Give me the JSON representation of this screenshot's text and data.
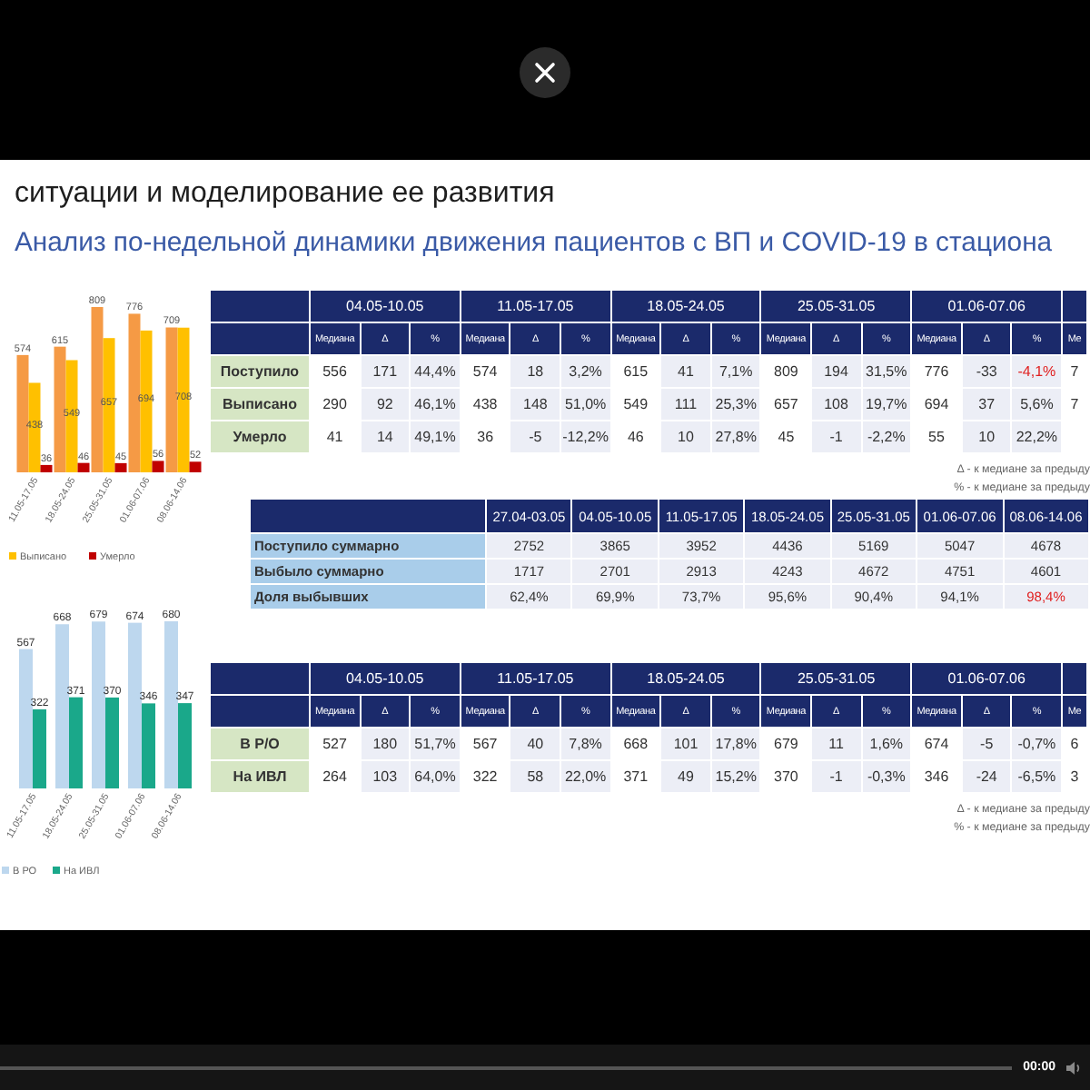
{
  "player": {
    "time": "00:00",
    "progress": {
      "level": 0
    }
  },
  "slide": {
    "heading": "ситуации и моделирование ее развития",
    "subtitle": "Анализ по-недельной динамики движения пациентов с ВП и COVID-19 в стациона",
    "admissions_chart": {
      "chart_data": {
        "type": "bar",
        "categories": [
          "11.05-17.05",
          "18.05-24.05",
          "25.05-31.05",
          "01.06-07.06",
          "08.06-14.06"
        ],
        "data_labels": true,
        "legend": true,
        "series": [
          {
            "color": "#f59a45",
            "values": [
              574,
              615,
              809,
              776,
              709
            ]
          },
          {
            "name": "Выписано",
            "color": "#ffc000",
            "values": [
              438,
              549,
              657,
              694,
              708
            ]
          },
          {
            "name": "Умерло",
            "color": "#c00000",
            "values": [
              36,
              46,
              45,
              56,
              52
            ]
          }
        ]
      }
    },
    "admissions_table": {
      "groups": [
        "04.05-10.05",
        "11.05-17.05",
        "18.05-24.05",
        "25.05-31.05",
        "01.06-07.06"
      ],
      "subheaders": [
        "Медиана",
        "Δ",
        "%",
        "Медиана",
        "Δ",
        "%",
        "Медиана",
        "Δ",
        "%",
        "Медиана",
        "Δ",
        "%",
        "Медиана",
        "Δ",
        "%",
        "Ме"
      ],
      "rows": [
        {
          "label": "Поступило",
          "cells": [
            {
              "text": "556",
              "alert": false
            },
            {
              "text": "171",
              "alert": false
            },
            {
              "text": "44,4%",
              "alert": false
            },
            {
              "text": "574",
              "alert": false
            },
            {
              "text": "18",
              "alert": false
            },
            {
              "text": "3,2%",
              "alert": false
            },
            {
              "text": "615",
              "alert": false
            },
            {
              "text": "41",
              "alert": false
            },
            {
              "text": "7,1%",
              "alert": false
            },
            {
              "text": "809",
              "alert": false
            },
            {
              "text": "194",
              "alert": false
            },
            {
              "text": "31,5%",
              "alert": false
            },
            {
              "text": "776",
              "alert": false
            },
            {
              "text": "-33",
              "alert": false
            },
            {
              "text": "-4,1%",
              "alert": true
            },
            {
              "text": "7",
              "alert": false
            }
          ]
        },
        {
          "label": "Выписано",
          "cells": [
            {
              "text": "290",
              "alert": false
            },
            {
              "text": "92",
              "alert": false
            },
            {
              "text": "46,1%",
              "alert": false
            },
            {
              "text": "438",
              "alert": false
            },
            {
              "text": "148",
              "alert": false
            },
            {
              "text": "51,0%",
              "alert": false
            },
            {
              "text": "549",
              "alert": false
            },
            {
              "text": "111",
              "alert": false
            },
            {
              "text": "25,3%",
              "alert": false
            },
            {
              "text": "657",
              "alert": false
            },
            {
              "text": "108",
              "alert": false
            },
            {
              "text": "19,7%",
              "alert": false
            },
            {
              "text": "694",
              "alert": false
            },
            {
              "text": "37",
              "alert": false
            },
            {
              "text": "5,6%",
              "alert": false
            },
            {
              "text": "7",
              "alert": false
            }
          ]
        },
        {
          "label": "Умерло",
          "cells": [
            {
              "text": "41",
              "alert": false
            },
            {
              "text": "14",
              "alert": false
            },
            {
              "text": "49,1%",
              "alert": false
            },
            {
              "text": "36",
              "alert": false
            },
            {
              "text": "-5",
              "alert": false
            },
            {
              "text": "-12,2%",
              "alert": false
            },
            {
              "text": "46",
              "alert": false
            },
            {
              "text": "10",
              "alert": false
            },
            {
              "text": "27,8%",
              "alert": false
            },
            {
              "text": "45",
              "alert": false
            },
            {
              "text": "-1",
              "alert": false
            },
            {
              "text": "-2,2%",
              "alert": false
            },
            {
              "text": "55",
              "alert": false
            },
            {
              "text": "10",
              "alert": false
            },
            {
              "text": "22,2%",
              "alert": false
            }
          ]
        }
      ],
      "notes": [
        "Δ - к медиане за предыду",
        "% - к медиане за предыду"
      ]
    },
    "cumulative_table": {
      "columns": [
        "27.04-03.05",
        "04.05-10.05",
        "11.05-17.05",
        "18.05-24.05",
        "25.05-31.05",
        "01.06-07.06",
        "08.06-14.06"
      ],
      "rows": [
        {
          "label": "Поступило суммарно",
          "cells": [
            {
              "text": "2752",
              "alert": false
            },
            {
              "text": "3865",
              "alert": false
            },
            {
              "text": "3952",
              "alert": false
            },
            {
              "text": "4436",
              "alert": false
            },
            {
              "text": "5169",
              "alert": false
            },
            {
              "text": "5047",
              "alert": false
            },
            {
              "text": "4678",
              "alert": false
            }
          ]
        },
        {
          "label": "Выбыло суммарно",
          "cells": [
            {
              "text": "1717",
              "alert": false
            },
            {
              "text": "2701",
              "alert": false
            },
            {
              "text": "2913",
              "alert": false
            },
            {
              "text": "4243",
              "alert": false
            },
            {
              "text": "4672",
              "alert": false
            },
            {
              "text": "4751",
              "alert": false
            },
            {
              "text": "4601",
              "alert": false
            }
          ]
        },
        {
          "label": "Доля выбывших",
          "cells": [
            {
              "text": "62,4%",
              "alert": false
            },
            {
              "text": "69,9%",
              "alert": false
            },
            {
              "text": "73,7%",
              "alert": false
            },
            {
              "text": "95,6%",
              "alert": false
            },
            {
              "text": "90,4%",
              "alert": false
            },
            {
              "text": "94,1%",
              "alert": false
            },
            {
              "text": "98,4%",
              "alert": true
            }
          ]
        }
      ]
    },
    "icu_chart": {
      "chart_data": {
        "type": "bar",
        "categories": [
          "11.05-17.05",
          "18.05-24.05",
          "25.05-31.05",
          "01.06-07.06",
          "08.06-14.06"
        ],
        "data_labels": true,
        "legend": true,
        "series": [
          {
            "name": "В РО",
            "color": "#bdd7ee",
            "values": [
              567,
              668,
              679,
              674,
              680
            ]
          },
          {
            "name": "На ИВЛ",
            "color": "#1aa88a",
            "values": [
              322,
              371,
              370,
              346,
              347
            ]
          }
        ]
      }
    },
    "icu_table": {
      "groups": [
        "04.05-10.05",
        "11.05-17.05",
        "18.05-24.05",
        "25.05-31.05",
        "01.06-07.06"
      ],
      "subheaders": [
        "Медиана",
        "Δ",
        "%",
        "Медиана",
        "Δ",
        "%",
        "Медиана",
        "Δ",
        "%",
        "Медиана",
        "Δ",
        "%",
        "Медиана",
        "Δ",
        "%",
        "Ме"
      ],
      "rows": [
        {
          "label": "В Р/О",
          "cells": [
            {
              "text": "527",
              "alert": false
            },
            {
              "text": "180",
              "alert": false
            },
            {
              "text": "51,7%",
              "alert": false
            },
            {
              "text": "567",
              "alert": false
            },
            {
              "text": "40",
              "alert": false
            },
            {
              "text": "7,8%",
              "alert": false
            },
            {
              "text": "668",
              "alert": false
            },
            {
              "text": "101",
              "alert": false
            },
            {
              "text": "17,8%",
              "alert": false
            },
            {
              "text": "679",
              "alert": false
            },
            {
              "text": "11",
              "alert": false
            },
            {
              "text": "1,6%",
              "alert": false
            },
            {
              "text": "674",
              "alert": false
            },
            {
              "text": "-5",
              "alert": false
            },
            {
              "text": "-0,7%",
              "alert": false
            },
            {
              "text": "6",
              "alert": false
            }
          ]
        },
        {
          "label": "На ИВЛ",
          "cells": [
            {
              "text": "264",
              "alert": false
            },
            {
              "text": "103",
              "alert": false
            },
            {
              "text": "64,0%",
              "alert": false
            },
            {
              "text": "322",
              "alert": false
            },
            {
              "text": "58",
              "alert": false
            },
            {
              "text": "22,0%",
              "alert": false
            },
            {
              "text": "371",
              "alert": false
            },
            {
              "text": "49",
              "alert": false
            },
            {
              "text": "15,2%",
              "alert": false
            },
            {
              "text": "370",
              "alert": false
            },
            {
              "text": "-1",
              "alert": false
            },
            {
              "text": "-0,3%",
              "alert": false
            },
            {
              "text": "346",
              "alert": false
            },
            {
              "text": "-24",
              "alert": false
            },
            {
              "text": "-6,5%",
              "alert": false
            },
            {
              "text": "3",
              "alert": false
            }
          ]
        }
      ],
      "notes": [
        "Δ - к медиане за предыду",
        "% - к медиане за предыду"
      ]
    }
  }
}
